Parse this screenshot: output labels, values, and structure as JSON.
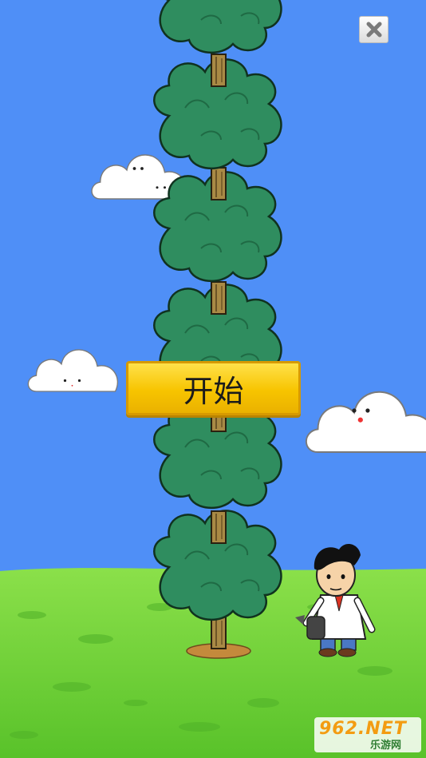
{
  "start_button": {
    "label": "开始"
  },
  "watermark": {
    "brand": "962.NET",
    "site": "乐游网"
  },
  "icons": {
    "close": "close-icon"
  },
  "colors": {
    "sky": "#4f8ff7",
    "grass": "#6fd23a",
    "tree_leaf": "#2f8d5f",
    "button_yellow": "#f7c400"
  }
}
